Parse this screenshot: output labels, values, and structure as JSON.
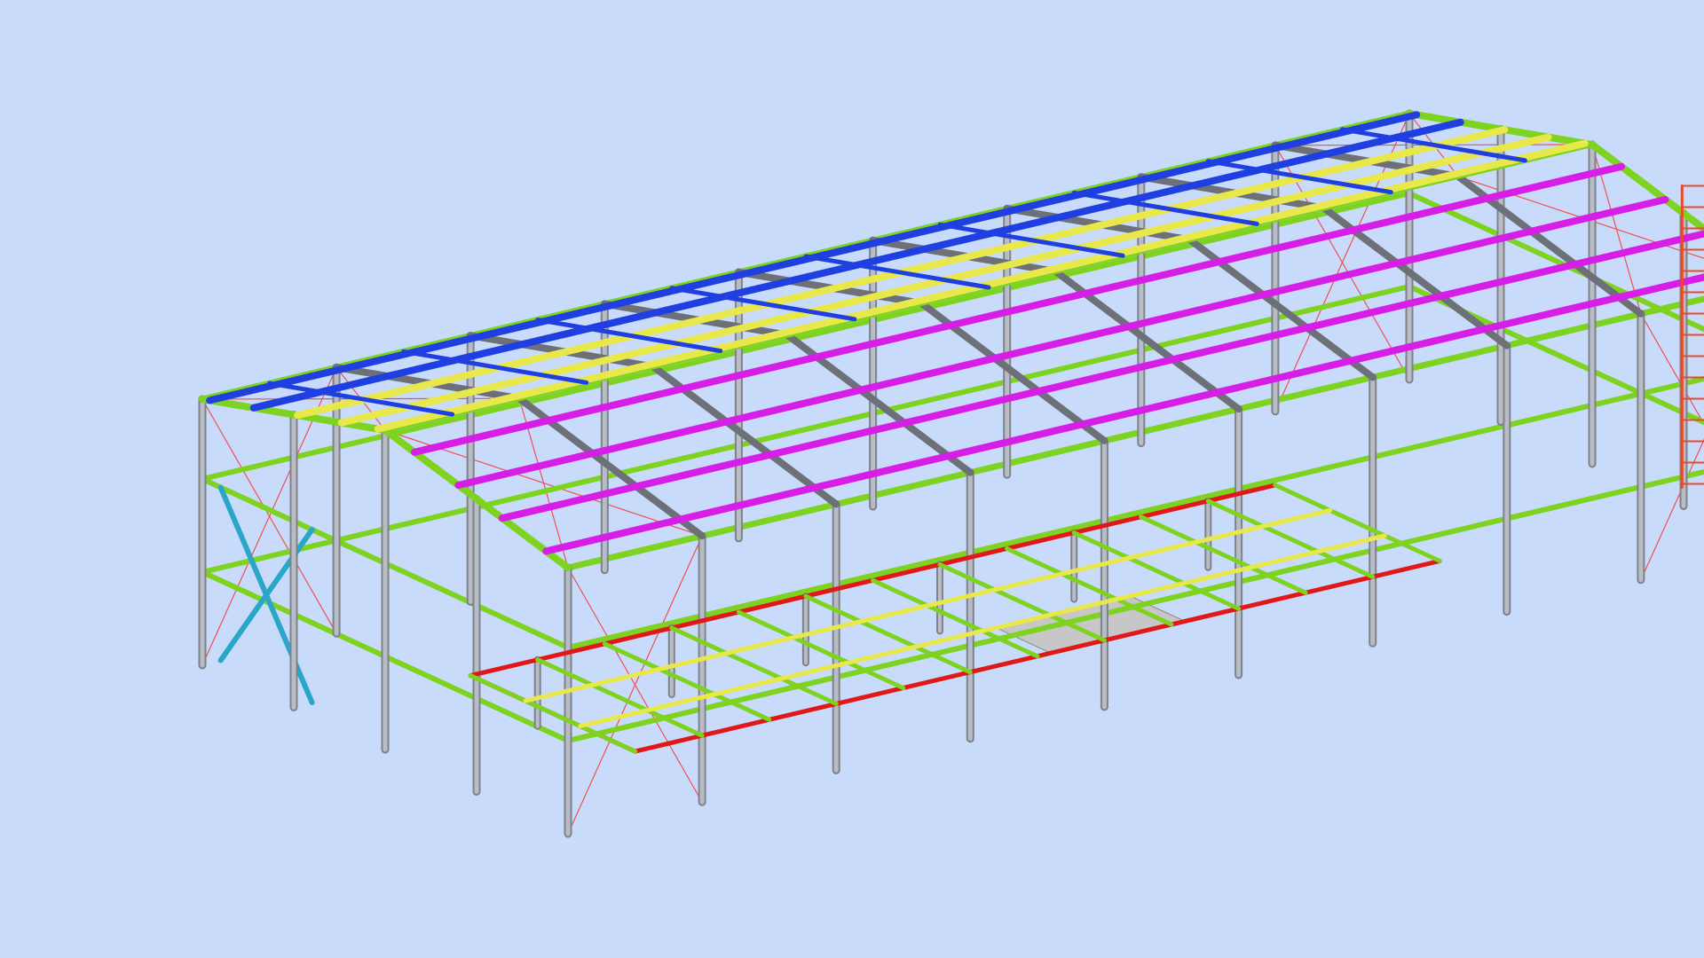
{
  "viewport": {
    "background_color": "#c9dbfb",
    "view": "isometric-3d"
  },
  "model": {
    "type": "steel-frame-building",
    "roof": "gable",
    "bays": 9,
    "element_colors": {
      "column": "#b8bcc4",
      "rafter": "#6e7078",
      "eave_beam": "#7ed321",
      "wall_girt": "#7ed321",
      "bracing": "#f05050",
      "roof_purlin_blue": "#1f3fe0",
      "roof_purlin_yellow": "#e8e84a",
      "roof_purlin_magenta": "#d61ee6",
      "strut_cyan": "#2aa6c8",
      "mezzanine_edge": "#e01818",
      "mezzanine_beam_yellow": "#e8e84a",
      "ladder": "#e84a2a",
      "floor_plate": "#c7c7c7"
    }
  }
}
